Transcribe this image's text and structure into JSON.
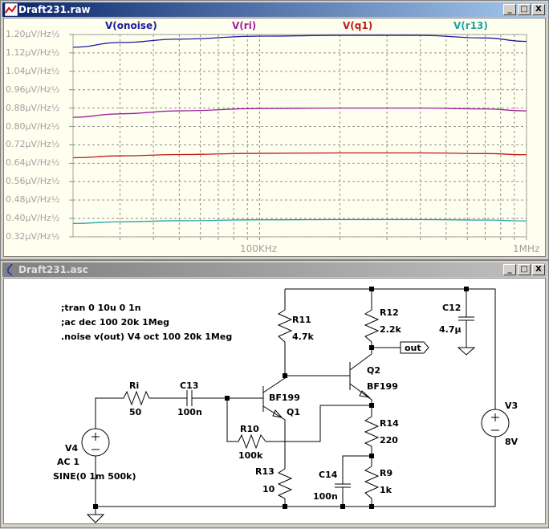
{
  "plot_window": {
    "title": "Draft231.raw",
    "minimize": "_",
    "maximize": "□",
    "close": "X"
  },
  "schematic_window": {
    "title": "Draft231.asc",
    "minimize": "_",
    "maximize": "□",
    "close": "X"
  },
  "chart_data": {
    "type": "line",
    "xscale": "log",
    "xlim": [
      20000,
      1000000
    ],
    "x_tick_labels": [
      "100KHz",
      "1MHz"
    ],
    "ylim": [
      0.32,
      1.2
    ],
    "y_tick_labels": [
      "1.20µV/Hz½",
      "1.12µV/Hz½",
      "1.04µV/Hz½",
      "0.96µV/Hz½",
      "0.88µV/Hz½",
      "0.80µV/Hz½",
      "0.72µV/Hz½",
      "0.64µV/Hz½",
      "0.56µV/Hz½",
      "0.48µV/Hz½",
      "0.40µV/Hz½",
      "0.32µV/Hz½"
    ],
    "grid": true,
    "x": [
      20000,
      30000,
      50000,
      100000,
      200000,
      400000,
      700000,
      1000000
    ],
    "series": [
      {
        "name": "V(onoise)",
        "color": "#1c1c9c",
        "values": [
          1.145,
          1.165,
          1.18,
          1.193,
          1.196,
          1.196,
          1.185,
          1.17
        ]
      },
      {
        "name": "V(ri)",
        "color": "#a020a0",
        "values": [
          0.84,
          0.855,
          0.868,
          0.878,
          0.88,
          0.88,
          0.876,
          0.868
        ]
      },
      {
        "name": "V(q1)",
        "color": "#c01818",
        "values": [
          0.664,
          0.672,
          0.678,
          0.683,
          0.685,
          0.685,
          0.682,
          0.677
        ]
      },
      {
        "name": "V(r13)",
        "color": "#20a0a8",
        "values": [
          0.378,
          0.385,
          0.39,
          0.394,
          0.395,
          0.395,
          0.393,
          0.389
        ]
      }
    ]
  },
  "schematic": {
    "directives": [
      ";tran 0 10u 0 1n",
      ";ac dec 100 20k 1Meg",
      ".noise v(out) V4 oct 100 20k 1Meg"
    ],
    "Ri": {
      "name": "Ri",
      "value": "50"
    },
    "C13": {
      "name": "C13",
      "value": "100n"
    },
    "R10": {
      "name": "R10",
      "value": "100k"
    },
    "R11": {
      "name": "R11",
      "value": "4.7k"
    },
    "R12": {
      "name": "R12",
      "value": "2.2k"
    },
    "R13": {
      "name": "R13",
      "value": "10"
    },
    "R14": {
      "name": "R14",
      "value": "220"
    },
    "R9": {
      "name": "R9",
      "value": "1k"
    },
    "C12": {
      "name": "C12",
      "value": "4.7µ"
    },
    "C14": {
      "name": "C14",
      "value": "100n"
    },
    "Q1": {
      "name": "Q1",
      "model": "BF199"
    },
    "Q2": {
      "name": "Q2",
      "model": "BF199"
    },
    "V3": {
      "name": "V3",
      "value": "8V"
    },
    "V4": {
      "name": "V4",
      "ac": "AC 1",
      "value": "SINE(0 1m 500k)"
    },
    "out_label": "out"
  }
}
